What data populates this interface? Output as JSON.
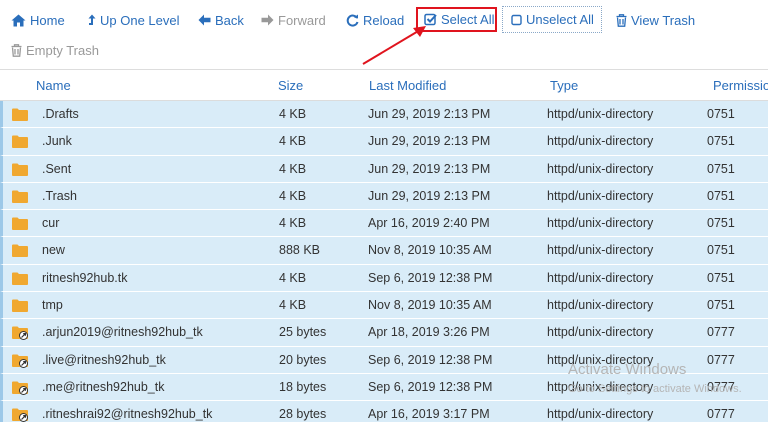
{
  "toolbar": {
    "home": "Home",
    "up_one_level": "Up One Level",
    "back": "Back",
    "forward": "Forward",
    "reload": "Reload",
    "select_all": "Select All",
    "unselect_all": "Unselect All",
    "view_trash": "View Trash",
    "empty_trash": "Empty Trash"
  },
  "columns": {
    "name": "Name",
    "size": "Size",
    "last_modified": "Last Modified",
    "type": "Type",
    "permissions": "Permissio"
  },
  "rows": [
    {
      "icon": "folder-icon",
      "name": ".Drafts",
      "size": "4 KB",
      "modified": "Jun 29, 2019 2:13 PM",
      "type": "httpd/unix-directory",
      "perm": "0751"
    },
    {
      "icon": "folder-icon",
      "name": ".Junk",
      "size": "4 KB",
      "modified": "Jun 29, 2019 2:13 PM",
      "type": "httpd/unix-directory",
      "perm": "0751"
    },
    {
      "icon": "folder-icon",
      "name": ".Sent",
      "size": "4 KB",
      "modified": "Jun 29, 2019 2:13 PM",
      "type": "httpd/unix-directory",
      "perm": "0751"
    },
    {
      "icon": "folder-icon",
      "name": ".Trash",
      "size": "4 KB",
      "modified": "Jun 29, 2019 2:13 PM",
      "type": "httpd/unix-directory",
      "perm": "0751"
    },
    {
      "icon": "folder-icon",
      "name": "cur",
      "size": "4 KB",
      "modified": "Apr 16, 2019 2:40 PM",
      "type": "httpd/unix-directory",
      "perm": "0751"
    },
    {
      "icon": "folder-icon",
      "name": "new",
      "size": "888 KB",
      "modified": "Nov 8, 2019 10:35 AM",
      "type": "httpd/unix-directory",
      "perm": "0751"
    },
    {
      "icon": "folder-icon",
      "name": "ritnesh92hub.tk",
      "size": "4 KB",
      "modified": "Sep 6, 2019 12:38 PM",
      "type": "httpd/unix-directory",
      "perm": "0751"
    },
    {
      "icon": "folder-icon",
      "name": "tmp",
      "size": "4 KB",
      "modified": "Nov 8, 2019 10:35 AM",
      "type": "httpd/unix-directory",
      "perm": "0751"
    },
    {
      "icon": "folder-link-icon",
      "name": ".arjun2019@ritnesh92hub_tk",
      "size": "25 bytes",
      "modified": "Apr 18, 2019 3:26 PM",
      "type": "httpd/unix-directory",
      "perm": "0777"
    },
    {
      "icon": "folder-link-icon",
      "name": ".live@ritnesh92hub_tk",
      "size": "20 bytes",
      "modified": "Sep 6, 2019 12:38 PM",
      "type": "httpd/unix-directory",
      "perm": "0777"
    },
    {
      "icon": "folder-link-icon",
      "name": ".me@ritnesh92hub_tk",
      "size": "18 bytes",
      "modified": "Sep 6, 2019 12:38 PM",
      "type": "httpd/unix-directory",
      "perm": "0777"
    },
    {
      "icon": "folder-link-icon",
      "name": ".ritneshrai92@ritnesh92hub_tk",
      "size": "28 bytes",
      "modified": "Apr 16, 2019 3:17 PM",
      "type": "httpd/unix-directory",
      "perm": "0777"
    }
  ],
  "watermark": {
    "title": "Activate Windows",
    "subtitle": "Go to Settings to activate Windows."
  },
  "colors": {
    "link": "#2a6ebb",
    "row_selected": "#d9ecf8",
    "folder": "#f0a830",
    "highlight_box": "#e0141e"
  }
}
